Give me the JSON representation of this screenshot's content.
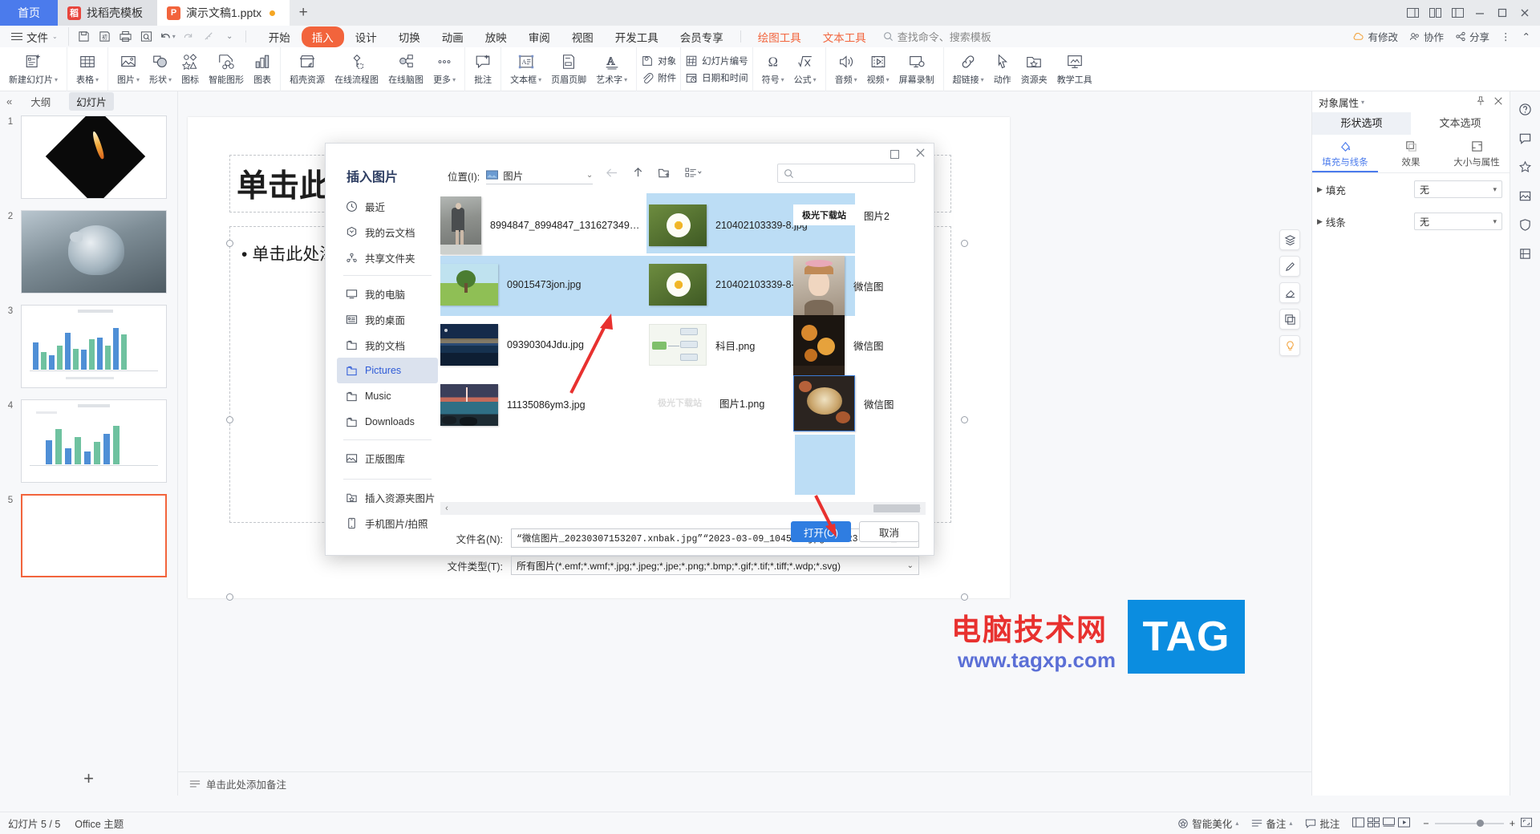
{
  "titlebar": {
    "home_tab": "首页",
    "tabs": [
      {
        "label": "找稻壳模板",
        "icon": "docer-icon",
        "color": "#e8453c",
        "glyph": "稻",
        "active": false,
        "modified": false
      },
      {
        "label": "演示文稿1.pptx",
        "icon": "wpp-icon",
        "color": "#f2643c",
        "glyph": "P",
        "active": true,
        "modified": true
      }
    ],
    "new_tab": "+",
    "window_buttons": [
      "restore-layout-icon",
      "grid-layout-icon",
      "split-layout-icon",
      "minimize-icon",
      "maximize-icon",
      "close-icon"
    ]
  },
  "menu": {
    "file": "文件",
    "quick_icons": [
      "save-icon",
      "save-as-icon",
      "print-icon",
      "print-preview-icon",
      "undo-icon",
      "redo-icon",
      "format-painter-icon",
      "customize-icon"
    ],
    "tabs": [
      {
        "label": "开始",
        "state": "normal"
      },
      {
        "label": "插入",
        "state": "selected"
      },
      {
        "label": "设计",
        "state": "normal"
      },
      {
        "label": "切换",
        "state": "normal"
      },
      {
        "label": "动画",
        "state": "normal"
      },
      {
        "label": "放映",
        "state": "normal"
      },
      {
        "label": "审阅",
        "state": "normal"
      },
      {
        "label": "视图",
        "state": "normal"
      },
      {
        "label": "开发工具",
        "state": "normal"
      },
      {
        "label": "会员专享",
        "state": "normal"
      }
    ],
    "context_tabs": [
      {
        "label": "绘图工具"
      },
      {
        "label": "文本工具"
      }
    ],
    "search_placeholder": "查找命令、搜索模板",
    "right_items": [
      {
        "label": "有修改",
        "icon": "cloud-sync-icon"
      },
      {
        "label": "协作",
        "icon": "collab-icon"
      },
      {
        "label": "分享",
        "icon": "share-icon"
      },
      {
        "label": "",
        "icon": "more-icon"
      },
      {
        "label": "",
        "icon": "collapse-ribbon-icon"
      }
    ]
  },
  "ribbon": {
    "groups": [
      {
        "items": [
          {
            "label": "新建幻灯片",
            "icon": "new-slide-icon",
            "caret": true
          }
        ]
      },
      {
        "items": [
          {
            "label": "表格",
            "icon": "table-icon",
            "caret": true
          }
        ]
      },
      {
        "items": [
          {
            "label": "图片",
            "icon": "picture-icon",
            "caret": true
          },
          {
            "label": "形状",
            "icon": "shapes-icon",
            "caret": true
          },
          {
            "label": "图标",
            "icon": "icons-icon",
            "caret": false
          },
          {
            "label": "智能图形",
            "icon": "smartart-icon",
            "caret": false
          },
          {
            "label": "图表",
            "icon": "chart-icon",
            "caret": false
          }
        ]
      },
      {
        "items": [
          {
            "label": "稻壳资源",
            "icon": "docer-resource-icon",
            "caret": false
          },
          {
            "label": "在线流程图",
            "icon": "online-flowchart-icon",
            "caret": false
          },
          {
            "label": "在线脑图",
            "icon": "online-mindmap-icon",
            "caret": false
          },
          {
            "label": "更多",
            "icon": "more-dots-icon",
            "caret": true
          }
        ]
      },
      {
        "items": [
          {
            "label": "批注",
            "icon": "comment-icon",
            "caret": false
          }
        ]
      },
      {
        "items": [
          {
            "label": "文本框",
            "icon": "textbox-icon",
            "caret": true
          },
          {
            "label": "页眉页脚",
            "icon": "header-footer-icon",
            "caret": false
          },
          {
            "label": "艺术字",
            "icon": "wordart-icon",
            "caret": true
          }
        ]
      },
      {
        "stacked": [
          {
            "label": "对象",
            "icon": "object-icon"
          },
          {
            "label": "附件",
            "icon": "attachment-icon"
          }
        ],
        "stacked2": [
          {
            "label": "幻灯片编号",
            "icon": "slide-number-icon"
          },
          {
            "label": "日期和时间",
            "icon": "date-time-icon"
          }
        ]
      },
      {
        "items": [
          {
            "label": "符号",
            "icon": "symbol-icon",
            "caret": true
          },
          {
            "label": "公式",
            "icon": "formula-icon",
            "caret": true
          }
        ]
      },
      {
        "items": [
          {
            "label": "音频",
            "icon": "audio-icon",
            "caret": true
          },
          {
            "label": "视频",
            "icon": "video-icon",
            "caret": true
          },
          {
            "label": "屏幕录制",
            "icon": "screen-record-icon",
            "caret": false
          }
        ]
      },
      {
        "items": [
          {
            "label": "超链接",
            "icon": "hyperlink-icon",
            "caret": true
          },
          {
            "label": "动作",
            "icon": "action-icon",
            "caret": false
          },
          {
            "label": "资源夹",
            "icon": "resource-folder-icon",
            "caret": false
          },
          {
            "label": "教学工具",
            "icon": "teaching-tool-icon",
            "caret": false
          }
        ]
      }
    ]
  },
  "left_panel": {
    "collapse_icon": "collapse-left-icon",
    "tabs": [
      {
        "label": "大纲",
        "selected": false
      },
      {
        "label": "幻灯片",
        "selected": true
      }
    ],
    "slides": [
      {
        "num": "1",
        "selected": false,
        "thumb": "black-diamond-flame"
      },
      {
        "num": "2",
        "selected": false,
        "thumb": "pigeon-photo"
      },
      {
        "num": "3",
        "selected": false,
        "thumb": "bar-chart-blue-green"
      },
      {
        "num": "4",
        "selected": false,
        "thumb": "bar-chart-blue"
      },
      {
        "num": "5",
        "selected": true,
        "thumb": "blank"
      }
    ],
    "add_slide": "+"
  },
  "canvas": {
    "title_placeholder": "单击此处添加标题",
    "body_placeholder": "单击此处添加文本",
    "notes_placeholder": "单击此处添加备注",
    "notes_icon": "notes-icon",
    "rail_buttons": [
      "zoom-fit-icon",
      "layers-icon",
      "pen-icon",
      "eraser-icon",
      "duplicate-icon",
      "lightbulb-icon"
    ]
  },
  "right_panel": {
    "title": "对象属性",
    "pin_icon": "pin-icon",
    "close_icon": "close-icon",
    "tabs": [
      {
        "label": "形状选项",
        "selected": true
      },
      {
        "label": "文本选项",
        "selected": false
      }
    ],
    "segments": [
      {
        "label": "填充与线条",
        "icon": "fill-line-icon",
        "selected": true
      },
      {
        "label": "效果",
        "icon": "effects-icon",
        "selected": false
      },
      {
        "label": "大小与属性",
        "icon": "size-props-icon",
        "selected": false
      }
    ],
    "rows": [
      {
        "label": "填充",
        "value": "无"
      },
      {
        "label": "线条",
        "value": "无"
      }
    ],
    "strip_icons": [
      "help-icon",
      "feedback-icon",
      "star-icon",
      "gallery-icon",
      "shield-icon",
      "crop-icon"
    ]
  },
  "dialog": {
    "title": "插入图片",
    "location_label": "位置(I):",
    "location_value": "图片",
    "location_icon": "picture-folder-icon",
    "nav_icons": [
      "back-arrow-icon",
      "up-arrow-icon",
      "new-folder-icon",
      "view-mode-icon"
    ],
    "search_placeholder": "",
    "search_icon": "search-icon",
    "restore_icon": "restore-icon",
    "close_icon": "close-icon",
    "sidebar": [
      {
        "label": "最近",
        "icon": "clock-icon",
        "selected": false
      },
      {
        "label": "我的云文档",
        "icon": "cloud-icon",
        "selected": false
      },
      {
        "label": "共享文件夹",
        "icon": "share-folder-icon",
        "selected": false
      },
      {
        "label": "我的电脑",
        "icon": "computer-icon",
        "selected": false
      },
      {
        "label": "我的桌面",
        "icon": "desktop-icon",
        "selected": false
      },
      {
        "label": "我的文档",
        "icon": "folder-icon",
        "selected": false
      },
      {
        "label": "Pictures",
        "icon": "folder-icon",
        "selected": true
      },
      {
        "label": "Music",
        "icon": "folder-icon",
        "selected": false
      },
      {
        "label": "Downloads",
        "icon": "folder-icon",
        "selected": false
      },
      {
        "label": "正版图库",
        "icon": "gallery-icon",
        "selected": false
      },
      {
        "label": "插入资源夹图片",
        "icon": "resource-folder-icon",
        "selected": false
      },
      {
        "label": "手机图片/拍照",
        "icon": "phone-icon",
        "selected": false
      }
    ],
    "files": [
      {
        "name": "8994847_8994847_1316273495879_m...",
        "thumb": "woman-walking-road",
        "selected": false,
        "col": 0,
        "row": 0
      },
      {
        "name": "210402103339-8.jpg",
        "thumb": "daisy-flower",
        "selected": true,
        "col": 1,
        "row": 0
      },
      {
        "name": "图片2",
        "thumb": "aurora-download-banner",
        "selected": true,
        "col": 2,
        "row": 0
      },
      {
        "name": "09015473jon.jpg",
        "thumb": "green-tree-field",
        "selected": true,
        "col": 0,
        "row": 1
      },
      {
        "name": "210402103339-8-1200.jpg",
        "thumb": "daisy-flower",
        "selected": true,
        "col": 1,
        "row": 1
      },
      {
        "name": "微信图",
        "thumb": "girl-flower-crown",
        "selected": false,
        "col": 2,
        "row": 1
      },
      {
        "name": "09390304Jdu.jpg",
        "thumb": "night-lake-mountain",
        "selected": false,
        "col": 0,
        "row": 2
      },
      {
        "name": "科目.png",
        "thumb": "mindmap-diagram",
        "selected": false,
        "col": 1,
        "row": 2
      },
      {
        "name": "微信图",
        "thumb": "flowers-dark",
        "selected": false,
        "col": 2,
        "row": 2
      },
      {
        "name": "11135086ym3.jpg",
        "thumb": "sea-sunset",
        "selected": false,
        "col": 0,
        "row": 3
      },
      {
        "name": "图片1.png",
        "thumb": "aurora-download-watermark",
        "selected": false,
        "col": 1,
        "row": 3
      },
      {
        "name": "微信图",
        "thumb": "flowers-basket",
        "selected": true,
        "col": 2,
        "row": 3
      }
    ],
    "scroll_left": "‹",
    "scroll_right": "›",
    "filename_label": "文件名(N):",
    "filename_value": "“微信图片_20230307153207.xnbak.jpg”“2023-03-09_104545.jpg”“2023-03-09_104545.png”“09015473jon.jpg”",
    "filetype_label": "文件类型(T):",
    "filetype_value": "所有图片(*.emf;*.wmf;*.jpg;*.jpeg;*.jpe;*.png;*.bmp;*.gif;*.tif;*.tiff;*.wdp;*.svg)",
    "open_button": "打开(O)",
    "cancel_button": "取消"
  },
  "status": {
    "slide_counter": "幻灯片 5 / 5",
    "theme": "Office 主题",
    "right_items": [
      {
        "label": "智能美化",
        "icon": "beautify-icon"
      },
      {
        "label": "备注",
        "icon": "notes-icon"
      },
      {
        "label": "批注",
        "icon": "comment-icon"
      }
    ],
    "view_icons": [
      "normal-view-icon",
      "sorter-view-icon",
      "reading-view-icon",
      "slideshow-icon"
    ],
    "zoom_out": "−",
    "zoom_in": "+",
    "zoom_level": "",
    "fit_icon": "fit-slide-icon"
  },
  "watermark": {
    "line1": "电脑技术网",
    "line2": "www.tagxp.com",
    "tag": "TAG"
  }
}
